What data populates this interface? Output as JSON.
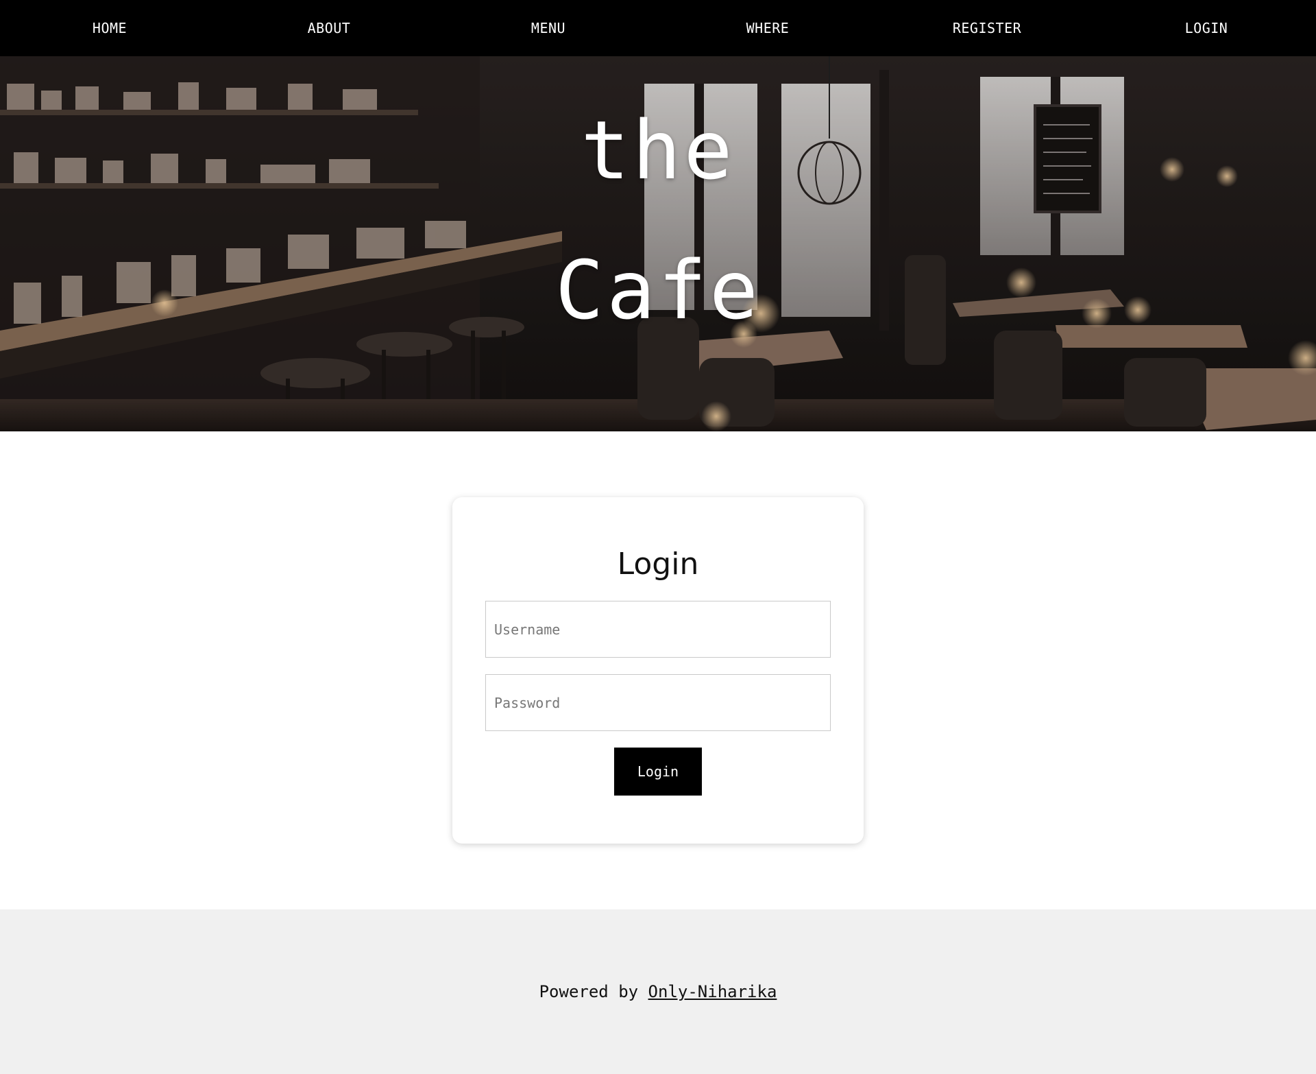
{
  "nav": {
    "items": [
      {
        "label": "HOME"
      },
      {
        "label": "ABOUT"
      },
      {
        "label": "MENU"
      },
      {
        "label": "WHERE"
      },
      {
        "label": "REGISTER"
      },
      {
        "label": "LOGIN"
      }
    ]
  },
  "hero": {
    "title_line1": "the",
    "title_line2": "Cafe"
  },
  "login": {
    "title": "Login",
    "username_placeholder": "Username",
    "username_value": "",
    "password_placeholder": "Password",
    "password_value": "",
    "button_label": "Login"
  },
  "footer": {
    "prefix": "Powered by",
    "link_text": "Only-Niharika"
  },
  "colors": {
    "nav_bg": "#000000",
    "nav_text": "#ffffff",
    "button_bg": "#000000",
    "footer_bg": "#f0f0f0"
  }
}
